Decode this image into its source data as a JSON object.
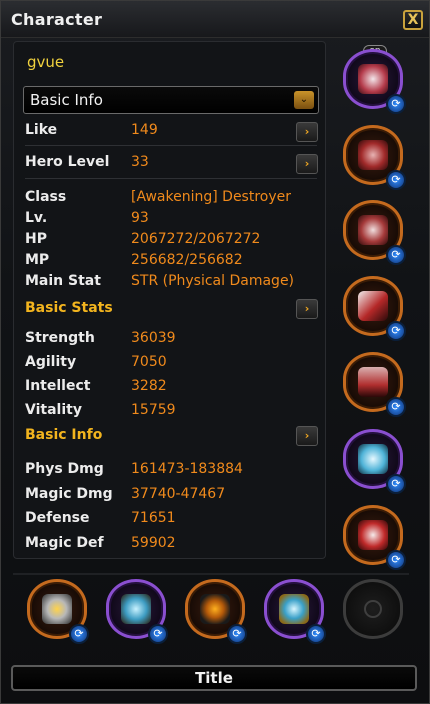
{
  "window": {
    "title": "Character",
    "close_glyph": "X"
  },
  "character": {
    "name": "gvue"
  },
  "dropdown": {
    "selected": "Basic Info",
    "arrow_glyph": "⌄"
  },
  "overview": [
    {
      "label": "Like",
      "value": "149",
      "has_button": true
    },
    {
      "label": "Hero Level",
      "value": "33",
      "has_button": true
    }
  ],
  "profile": [
    {
      "label": "Class",
      "value": "[Awakening] Destroyer"
    },
    {
      "label": "Lv.",
      "value": "93"
    },
    {
      "label": "HP",
      "value": "2067272/2067272"
    },
    {
      "label": "MP",
      "value": "256682/256682"
    },
    {
      "label": "Main Stat",
      "value": "STR (Physical Damage)"
    }
  ],
  "basic_stats": {
    "heading": "Basic Stats",
    "rows": [
      {
        "label": "Strength",
        "value": "36039"
      },
      {
        "label": "Agility",
        "value": "7050"
      },
      {
        "label": "Intellect",
        "value": "3282"
      },
      {
        "label": "Vitality",
        "value": "15759"
      }
    ]
  },
  "basic_info": {
    "heading": "Basic Info",
    "rows": [
      {
        "label": "Phys Dmg",
        "value": "161473-183884"
      },
      {
        "label": "Magic Dmg",
        "value": "37740-47467"
      },
      {
        "label": "Defense",
        "value": "71651"
      },
      {
        "label": "Magic Def",
        "value": "59902"
      }
    ]
  },
  "more_glyph": "›",
  "swap_glyph": "⟳",
  "equipment_right": [
    {
      "slot": "helmet",
      "rarity": "purple",
      "icon": "helmet-icon",
      "badge": "on"
    },
    {
      "slot": "chest",
      "rarity": "orange",
      "icon": "chest-armor-icon"
    },
    {
      "slot": "gloves",
      "rarity": "orange",
      "icon": "gloves-icon"
    },
    {
      "slot": "weapon",
      "rarity": "orange",
      "icon": "weapon-icon"
    },
    {
      "slot": "legs",
      "rarity": "orange",
      "icon": "leg-armor-icon"
    },
    {
      "slot": "wings",
      "rarity": "purple",
      "icon": "wings-icon"
    },
    {
      "slot": "boots",
      "rarity": "orange",
      "icon": "boots-icon"
    }
  ],
  "equipment_bottom": [
    {
      "slot": "necklace",
      "rarity": "orange",
      "icon": "necklace-icon"
    },
    {
      "slot": "earrings",
      "rarity": "purple",
      "icon": "earrings-icon"
    },
    {
      "slot": "ring-1",
      "rarity": "orange",
      "icon": "ring-icon"
    },
    {
      "slot": "ring-2",
      "rarity": "purple",
      "icon": "ring-icon"
    },
    {
      "slot": "empty",
      "rarity": "empty",
      "icon": "empty-slot-icon"
    }
  ],
  "colors": {
    "name": "#f1d23e",
    "value": "#f08a1c",
    "section": "#f2b41e",
    "orange_frame": "#c46a1e",
    "purple_frame": "#8a4fd0",
    "swap": "#2f8cff"
  },
  "footer": {
    "title_button": "Title"
  }
}
